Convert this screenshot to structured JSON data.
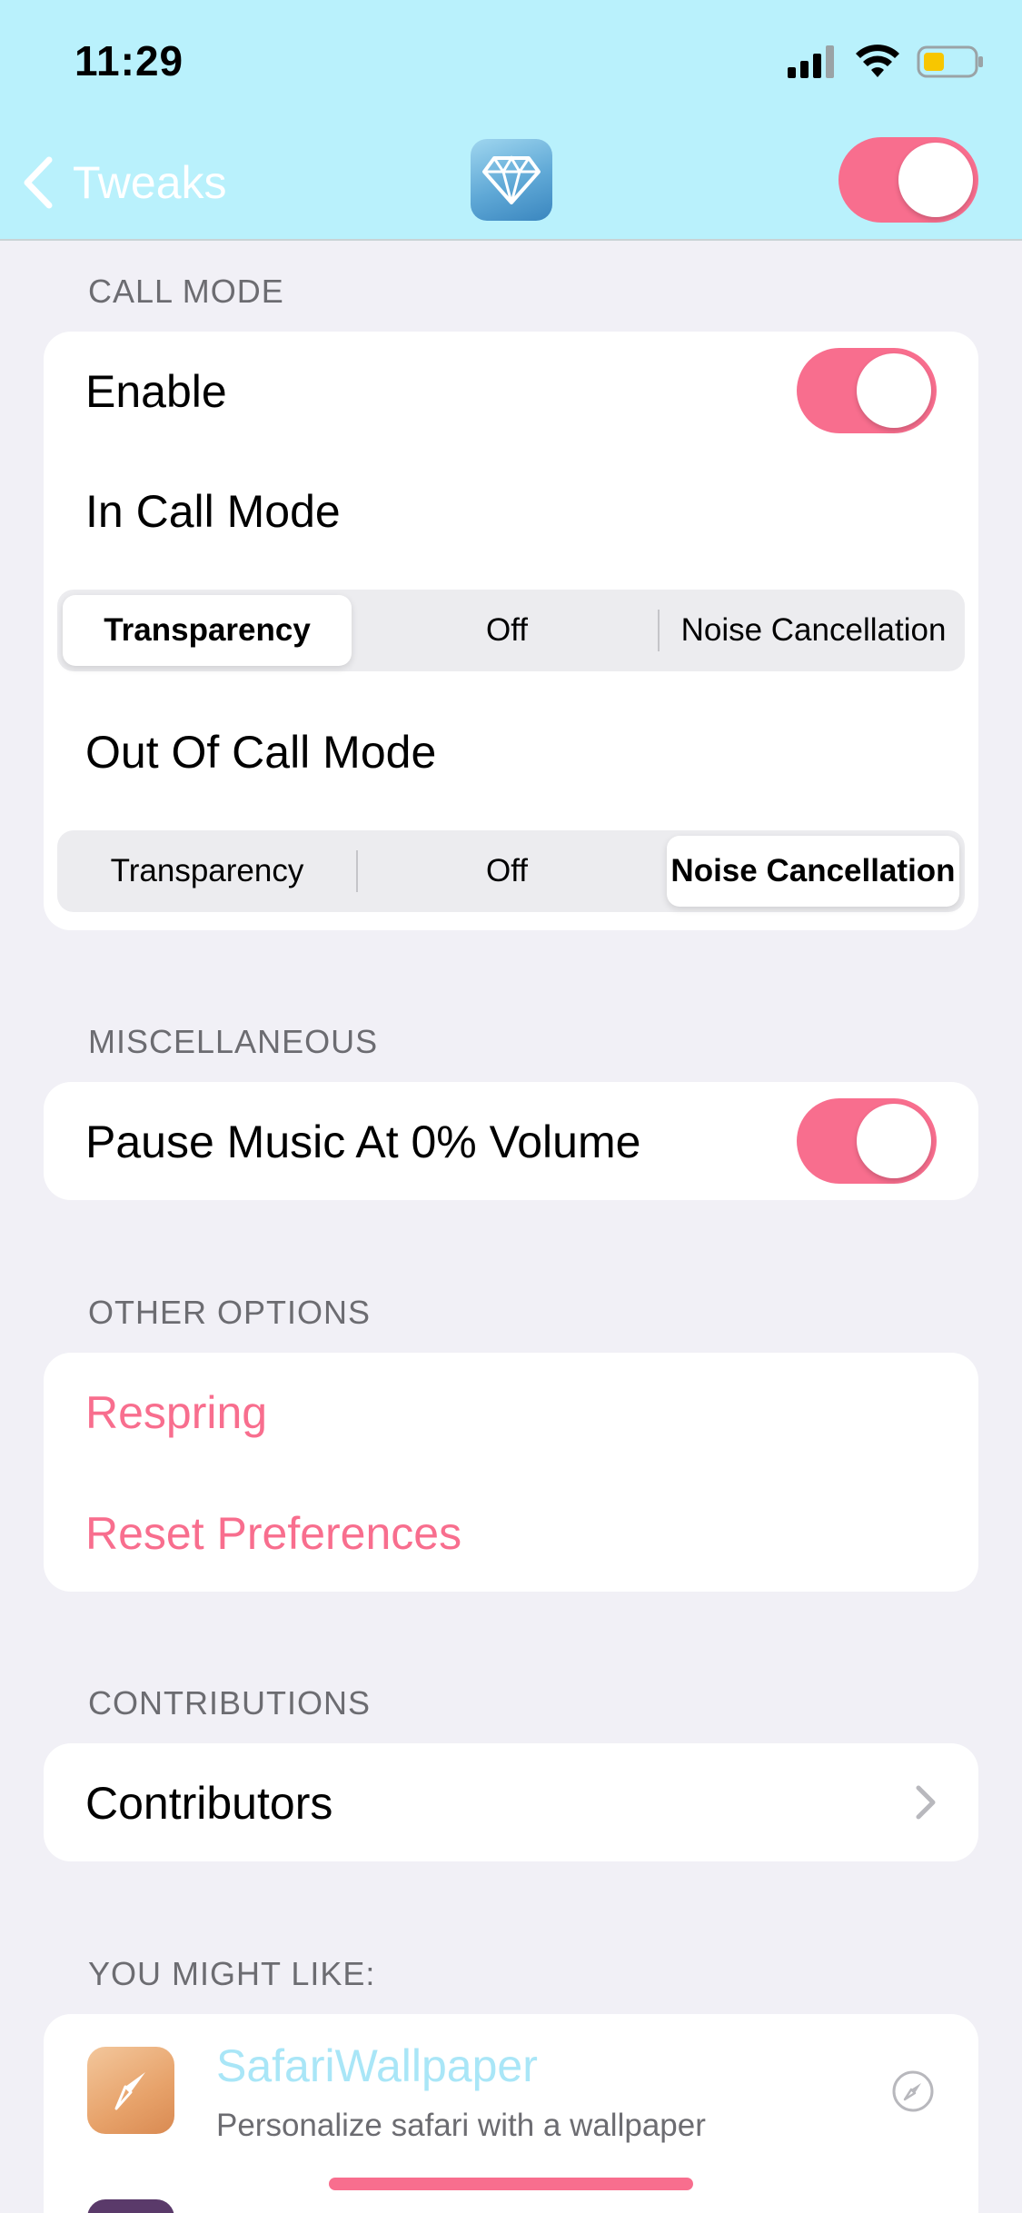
{
  "status_bar": {
    "time": "11:29"
  },
  "nav": {
    "back_label": "Tweaks",
    "master_switch_on": true
  },
  "colors": {
    "accent": "#f86e8e",
    "header_bg": "#b9f1fc",
    "link_blue": "#a9e6f7"
  },
  "sections": {
    "call_mode": {
      "header": "CALL MODE",
      "enable_label": "Enable",
      "enable_on": true,
      "in_call_label": "In Call Mode",
      "in_call_options": [
        "Transparency",
        "Off",
        "Noise Cancellation"
      ],
      "in_call_selected": "Transparency",
      "out_call_label": "Out Of Call Mode",
      "out_call_options": [
        "Transparency",
        "Off",
        "Noise Cancellation"
      ],
      "out_call_selected": "Noise Cancellation"
    },
    "misc": {
      "header": "MISCELLANEOUS",
      "pause_label": "Pause Music At 0% Volume",
      "pause_on": true
    },
    "other": {
      "header": "OTHER OPTIONS",
      "respring": "Respring",
      "reset": "Reset Preferences"
    },
    "contributions": {
      "header": "CONTRIBUTIONS",
      "contributors": "Contributors"
    },
    "might_like": {
      "header": "YOU MIGHT LIKE:",
      "items": [
        {
          "title": "SafariWallpaper",
          "subtitle": "Personalize safari with a wallpaper",
          "icon": "safari-wallpaper-icon"
        }
      ]
    }
  }
}
